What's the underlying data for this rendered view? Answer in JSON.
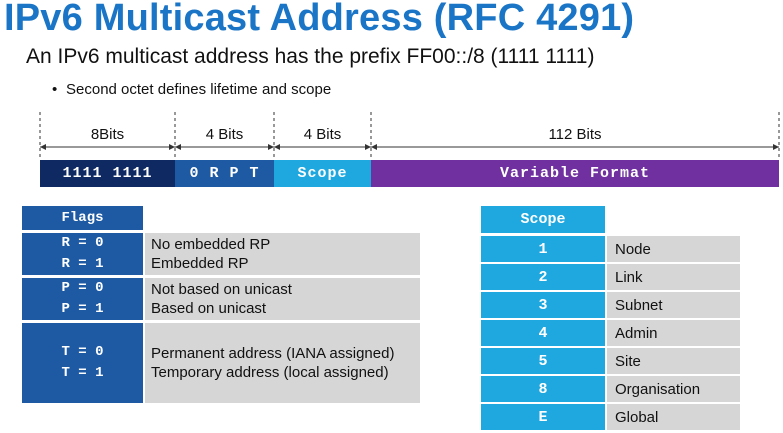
{
  "title": "IPv6 Multicast Address (RFC 4291)",
  "subtitle": "An IPv6 multicast address has the prefix FF00::/8 (1111 1111)",
  "bullet": "Second octet defines lifetime and scope",
  "bullet_mark": "•",
  "fields": [
    {
      "bits": "8Bits",
      "value": "1111 1111",
      "color": "#0f2a63"
    },
    {
      "bits": "4 Bits",
      "value": "0 R P T",
      "color": "#1d5aa3"
    },
    {
      "bits": "4 Bits",
      "value": "Scope",
      "color": "#1fa8e0"
    },
    {
      "bits": "112 Bits",
      "value": "Variable Format",
      "color": "#7030a0"
    }
  ],
  "flags": {
    "header": "Flags",
    "rows": [
      {
        "codes": [
          "R = 0",
          "R = 1"
        ],
        "descriptions": [
          "No embedded RP",
          "Embedded RP"
        ]
      },
      {
        "codes": [
          "P = 0",
          "P = 1"
        ],
        "descriptions": [
          "Not based on unicast",
          "Based on unicast"
        ]
      },
      {
        "codes": [
          "T = 0",
          "T = 1"
        ],
        "descriptions": [
          "Permanent address (IANA assigned)",
          "Temporary address (local assigned)"
        ]
      }
    ]
  },
  "scope": {
    "header": "Scope",
    "rows": [
      {
        "code": "1",
        "name": "Node"
      },
      {
        "code": "2",
        "name": "Link"
      },
      {
        "code": "3",
        "name": "Subnet"
      },
      {
        "code": "4",
        "name": "Admin"
      },
      {
        "code": "5",
        "name": "Site"
      },
      {
        "code": "8",
        "name": "Organisation"
      },
      {
        "code": "E",
        "name": "Global"
      }
    ]
  }
}
